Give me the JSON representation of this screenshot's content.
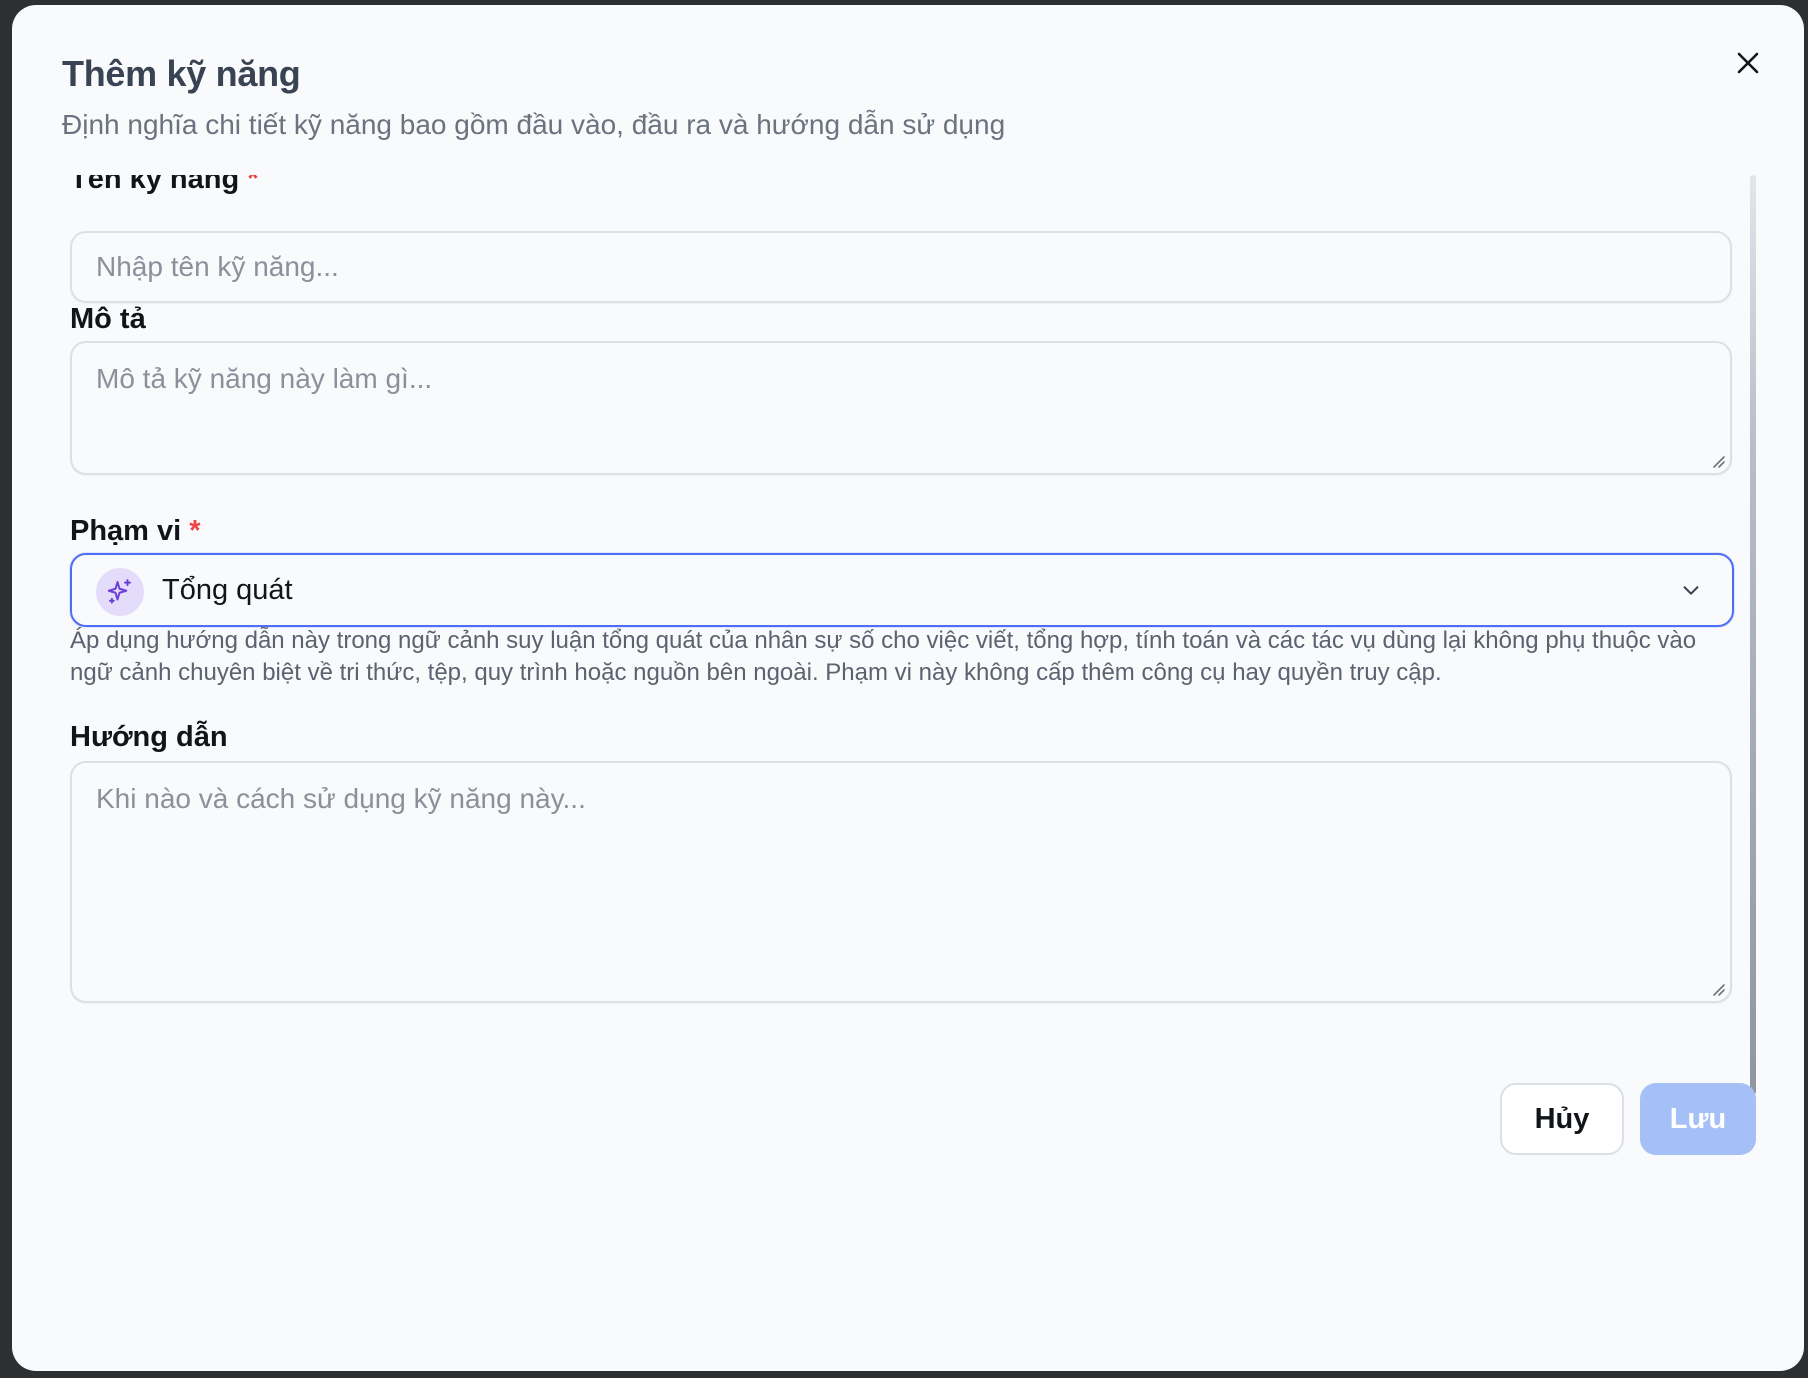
{
  "dialog": {
    "title": "Thêm kỹ năng",
    "subtitle": "Định nghĩa chi tiết kỹ năng bao gồm đầu vào, đầu ra và hướng dẫn sử dụng",
    "close_icon": "close-icon"
  },
  "form": {
    "name": {
      "label": "Tên kỹ năng",
      "required_mark": "*",
      "placeholder": "Nhập tên kỹ năng...",
      "value": ""
    },
    "description": {
      "label": "Mô tả",
      "placeholder": "Mô tả kỹ năng này làm gì...",
      "value": ""
    },
    "scope": {
      "label": "Phạm vi",
      "required_mark": "*",
      "selected": "Tổng quát",
      "icon": "sparkles-icon",
      "help": "Áp dụng hướng dẫn này trong ngữ cảnh suy luận tổng quát của nhân sự số cho việc viết, tổng hợp, tính toán và các tác vụ dùng lại không phụ thuộc vào ngữ cảnh chuyên biệt về tri thức, tệp, quy trình hoặc nguồn bên ngoài. Phạm vi này không cấp thêm công cụ hay quyền truy cập."
    },
    "instructions": {
      "label": "Hướng dẫn",
      "placeholder": "Khi nào và cách sử dụng kỹ năng này...",
      "value": ""
    }
  },
  "actions": {
    "cancel_label": "Hủy",
    "save_label": "Lưu"
  },
  "colors": {
    "accent": "#4f6ef5",
    "save_disabled": "#a5c0f7",
    "required": "#ef4444",
    "scope_icon_bg": "#e4dcfb"
  }
}
